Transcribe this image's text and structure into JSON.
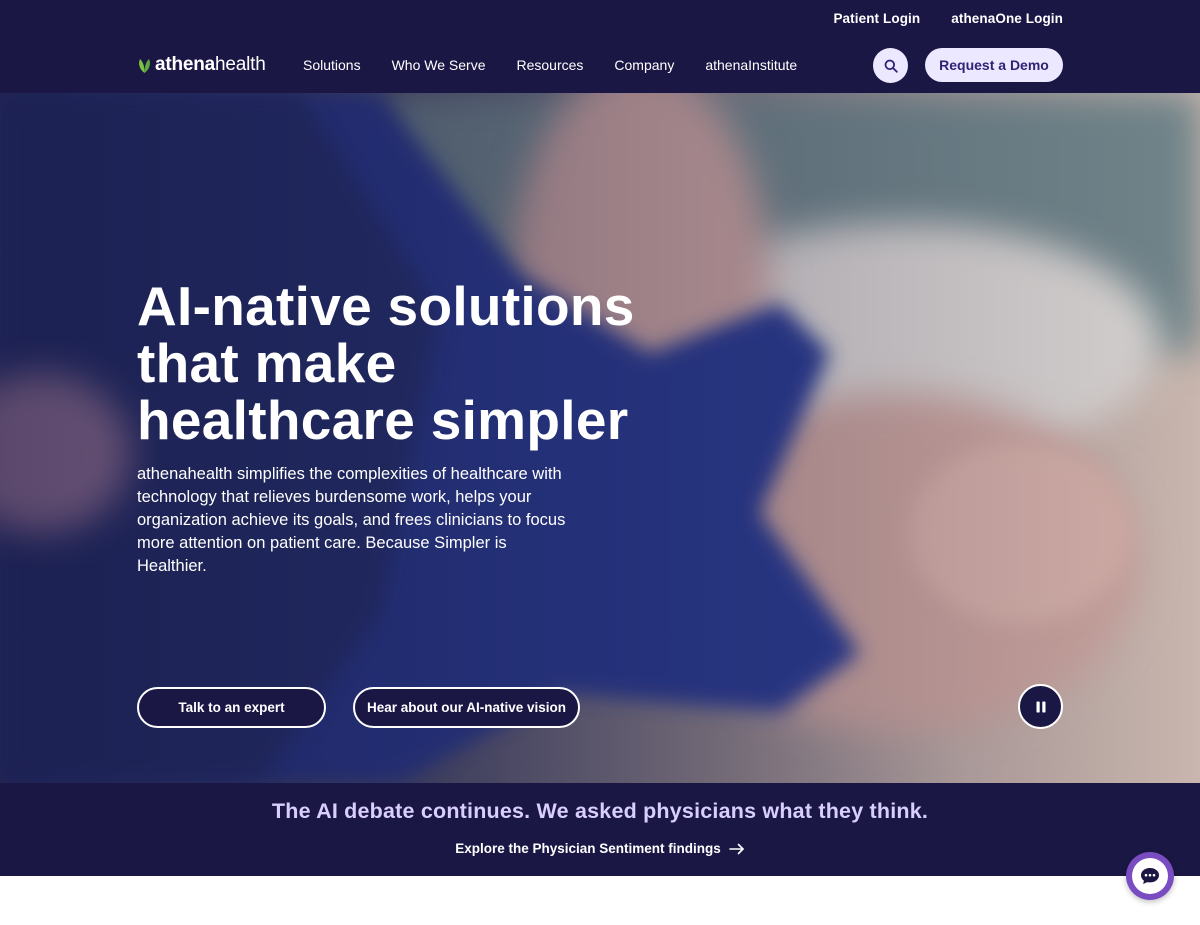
{
  "header": {
    "utility_links": {
      "patient_login": "Patient Login",
      "athenaone_login": "athenaOne Login"
    },
    "logo": {
      "part1": "athena",
      "part2": "health"
    },
    "nav": {
      "solutions": "Solutions",
      "who_we_serve": "Who We Serve",
      "resources": "Resources",
      "company": "Company",
      "athenainstitute": "athenaInstitute"
    },
    "search_icon": "search-icon",
    "demo_button": "Request a Demo"
  },
  "hero": {
    "title_line1": "AI-native solutions",
    "title_line2": "that make",
    "title_line3": "healthcare simpler",
    "subtitle": "athenahealth simplifies the complexities of healthcare with technology that relieves burdensome work, helps your organization achieve its goals, and frees clinicians to focus more attention on patient care. Because Simpler is Healthier.",
    "cta_expert": "Talk to an expert",
    "cta_vision": "Hear about our AI-native vision",
    "pause_icon": "pause-icon"
  },
  "banner": {
    "headline": "The AI debate continues. We asked physicians what they think.",
    "link": "Explore the Physician Sentiment findings",
    "arrow_icon": "arrow-right-icon"
  },
  "chat": {
    "icon": "chat-bubble-icon"
  },
  "colors": {
    "navy": "#1b1745",
    "lavender": "#ece8ff",
    "banner_headline": "#d8cfff",
    "brand_green": "#7cc142",
    "chat_purple": "#7a4cc2"
  }
}
